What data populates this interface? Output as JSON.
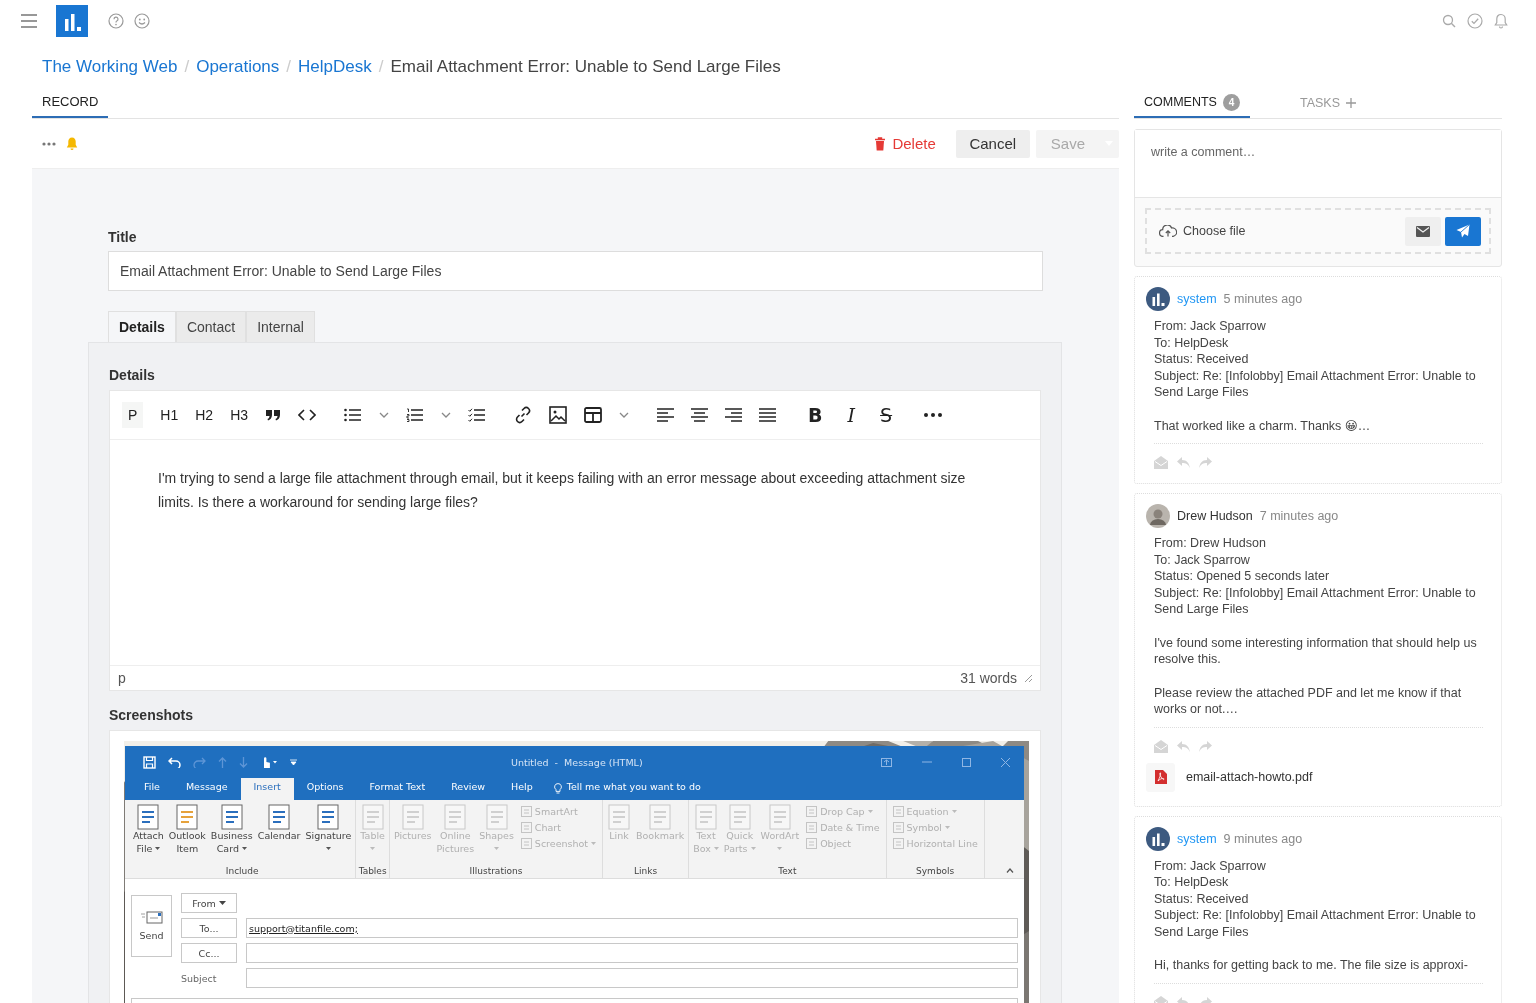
{
  "breadcrumb": {
    "separator": "/",
    "links": [
      "The Working Web",
      "Operations",
      "HelpDesk"
    ],
    "current": "Email Attachment Error: Unable to Send Large Files"
  },
  "record_tabs": [
    {
      "label": "RECORD",
      "selected": true
    }
  ],
  "actions": {
    "delete": "Delete",
    "cancel": "Cancel",
    "save": {
      "label": "Save",
      "disabled": true
    }
  },
  "form": {
    "title_label": "Title",
    "title_value": "Email Attachment Error: Unable to Send Large Files",
    "tabs": [
      {
        "label": "Details",
        "selected": true
      },
      {
        "label": "Contact",
        "selected": false
      },
      {
        "label": "Internal",
        "selected": false
      }
    ],
    "details": {
      "label": "Details",
      "format_buttons": [
        {
          "label": "P",
          "selected": true
        },
        {
          "label": "H1",
          "selected": false
        },
        {
          "label": "H2",
          "selected": false
        },
        {
          "label": "H3",
          "selected": false
        }
      ],
      "style_buttons": [
        {
          "label": "B",
          "kind": "bold"
        },
        {
          "label": "I",
          "kind": "italic"
        },
        {
          "label": "S",
          "kind": "strike"
        }
      ],
      "body": "I'm trying to send a large file attachment through email, but it keeps failing with an error message about exceeding attachment size limits. Is there a workaround for sending large files?",
      "status_path": "p",
      "word_count": "31 words"
    },
    "screenshots": {
      "label": "Screenshots",
      "outlook": {
        "title": "Untitled  -  Message (HTML)",
        "ribbon_tabs": [
          {
            "label": "File",
            "selected": false
          },
          {
            "label": "Message",
            "selected": false
          },
          {
            "label": "Insert",
            "selected": true
          },
          {
            "label": "Options",
            "selected": false
          },
          {
            "label": "Format Text",
            "selected": false
          },
          {
            "label": "Review",
            "selected": false
          },
          {
            "label": "Help",
            "selected": false
          }
        ],
        "tell_me": "Tell me what you want to do",
        "groups": [
          {
            "name": "Include",
            "items": [
              {
                "kind": "large",
                "lines": [
                  "Attach",
                  "File"
                ],
                "caret": true,
                "disabled": false
              },
              {
                "kind": "large",
                "lines": [
                  "Outlook",
                  "Item"
                ],
                "disabled": false
              },
              {
                "kind": "large",
                "lines": [
                  "Business",
                  "Card"
                ],
                "caret": true,
                "disabled": false
              },
              {
                "kind": "large",
                "lines": [
                  "Calendar"
                ],
                "disabled": false
              },
              {
                "kind": "large",
                "lines": [
                  "Signature"
                ],
                "caret_below": true,
                "disabled": false
              }
            ]
          },
          {
            "name": "Tables",
            "items": [
              {
                "kind": "large",
                "lines": [
                  "Table"
                ],
                "caret_below": true,
                "disabled": true
              }
            ]
          },
          {
            "name": "Illustrations",
            "items": [
              {
                "kind": "large",
                "lines": [
                  "Pictures"
                ],
                "disabled": true
              },
              {
                "kind": "large",
                "lines": [
                  "Online",
                  "Pictures"
                ],
                "disabled": true
              },
              {
                "kind": "large",
                "lines": [
                  "Shapes"
                ],
                "caret_below": true,
                "disabled": true
              },
              {
                "kind": "stack",
                "entries": [
                  {
                    "label": "SmartArt",
                    "disabled": true
                  },
                  {
                    "label": "Chart",
                    "disabled": true
                  },
                  {
                    "label": "Screenshot",
                    "caret": true,
                    "disabled": true
                  }
                ]
              }
            ]
          },
          {
            "name": "Links",
            "items": [
              {
                "kind": "large",
                "lines": [
                  "Link"
                ],
                "disabled": true
              },
              {
                "kind": "large",
                "lines": [
                  "Bookmark"
                ],
                "disabled": true
              }
            ]
          },
          {
            "name": "Text",
            "items": [
              {
                "kind": "large",
                "lines": [
                  "Text",
                  "Box"
                ],
                "caret": true,
                "disabled": true
              },
              {
                "kind": "large",
                "lines": [
                  "Quick",
                  "Parts"
                ],
                "caret": true,
                "disabled": true
              },
              {
                "kind": "large",
                "lines": [
                  "WordArt"
                ],
                "caret_below": true,
                "disabled": true
              },
              {
                "kind": "stack",
                "entries": [
                  {
                    "label": "Drop Cap",
                    "caret": true,
                    "disabled": true
                  },
                  {
                    "label": "Date & Time",
                    "disabled": true
                  },
                  {
                    "label": "Object",
                    "disabled": true
                  }
                ]
              }
            ]
          },
          {
            "name": "Symbols",
            "items": [
              {
                "kind": "stack",
                "entries": [
                  {
                    "label": "Equation",
                    "caret": true,
                    "disabled": true
                  },
                  {
                    "label": "Symbol",
                    "caret": true,
                    "disabled": true
                  },
                  {
                    "label": "Horizontal Line",
                    "disabled": true
                  }
                ]
              }
            ]
          }
        ],
        "send": "Send",
        "from": "From",
        "to": "To...",
        "cc": "Cc...",
        "subject": "Subject",
        "to_value": "support@titanfile.com;"
      }
    }
  },
  "comments_panel": {
    "tabs": [
      {
        "label": "COMMENTS",
        "count": "4",
        "selected": true
      },
      {
        "label": "TASKS",
        "selected": false
      }
    ],
    "placeholder": "write a comment…",
    "choose_file": "Choose file",
    "comments": [
      {
        "author": "system",
        "kind": "system",
        "time": "5 minutes ago",
        "header_lines": [
          "From: Jack Sparrow",
          "To: HelpDesk",
          "Status: Received",
          "Subject: Re: [Infolobby] Email Attachment Error: Unable to Send Large Files"
        ],
        "paragraphs": [
          "That worked like a charm. Thanks 😀…"
        ]
      },
      {
        "author": "Drew Hudson",
        "kind": "user",
        "time": "7 minutes ago",
        "header_lines": [
          "From: Drew Hudson",
          "To: Jack Sparrow",
          "Status: Opened 5 seconds later",
          "Subject: Re: [Infolobby] Email Attachment Error: Unable to Send Large Files"
        ],
        "paragraphs": [
          "I've found some interesting information that should help us resolve this.",
          "Please review the attached PDF and let me know if that works or not.…"
        ],
        "attachment": "email-attach-howto.pdf"
      },
      {
        "author": "system",
        "kind": "system",
        "time": "9 minutes ago",
        "header_lines": [
          "From: Jack Sparrow",
          "To: HelpDesk",
          "Status: Received",
          "Subject: Re: [Infolobby] Email Attachment Error: Unable to Send Large Files"
        ],
        "paragraphs": [
          "Hi, thanks for getting back to me. The file size is approxi-"
        ]
      }
    ]
  }
}
